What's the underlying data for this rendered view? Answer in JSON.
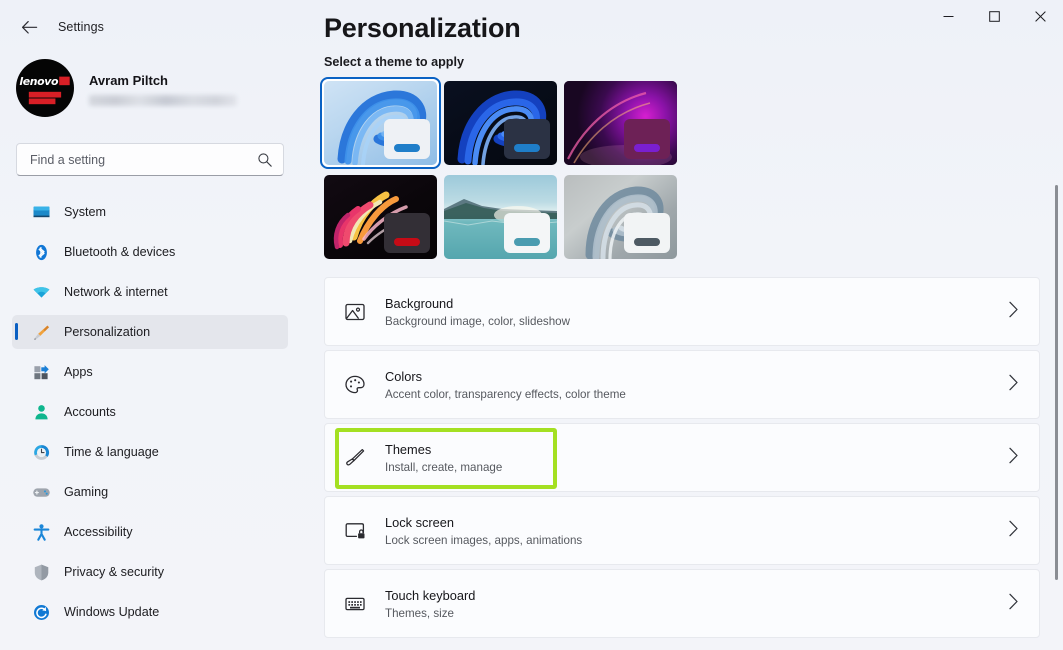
{
  "window": {
    "app_title": "Settings",
    "back_icon": "back-arrow-icon",
    "controls": {
      "minimize_label": "Minimize",
      "maximize_label": "Maximize",
      "close_label": "Close"
    }
  },
  "account": {
    "name": "Avram Piltch",
    "email_redacted": true,
    "avatar_logo_text": "lenovo"
  },
  "search": {
    "placeholder": "Find a setting",
    "value": "",
    "icon": "search-icon"
  },
  "sidebar": {
    "items": [
      {
        "label": "System",
        "icon": "monitor-icon",
        "active": false
      },
      {
        "label": "Bluetooth & devices",
        "icon": "bluetooth-icon",
        "active": false
      },
      {
        "label": "Network & internet",
        "icon": "wifi-icon",
        "active": false
      },
      {
        "label": "Personalization",
        "icon": "paintbrush-icon",
        "active": true
      },
      {
        "label": "Apps",
        "icon": "apps-icon",
        "active": false
      },
      {
        "label": "Accounts",
        "icon": "person-icon",
        "active": false
      },
      {
        "label": "Time & language",
        "icon": "clock-icon",
        "active": false
      },
      {
        "label": "Gaming",
        "icon": "gamepad-icon",
        "active": false
      },
      {
        "label": "Accessibility",
        "icon": "accessibility-icon",
        "active": false
      },
      {
        "label": "Privacy & security",
        "icon": "shield-icon",
        "active": false
      },
      {
        "label": "Windows Update",
        "icon": "update-icon",
        "active": false
      }
    ]
  },
  "main": {
    "page_title": "Personalization",
    "section_label": "Select a theme to apply",
    "themes": [
      {
        "name": "Windows light bloom",
        "selected": true,
        "accent": "#1f7ec9",
        "win_bg": "#eef1f5"
      },
      {
        "name": "Windows dark bloom",
        "selected": false,
        "accent": "#1f7ec9",
        "win_bg": "#2b3244"
      },
      {
        "name": "Purple glow",
        "selected": false,
        "accent": "#7a1fd0",
        "win_bg": "#6d2156"
      },
      {
        "name": "Flow flowers dark",
        "selected": false,
        "accent": "#c60b16",
        "win_bg": "#332f36"
      },
      {
        "name": "Captured motion lake",
        "selected": false,
        "accent": "#4a9cb0",
        "win_bg": "#f4f6f7"
      },
      {
        "name": "Flow light",
        "selected": false,
        "accent": "#4e5a63",
        "win_bg": "#f2f4f5"
      }
    ],
    "settings_rows": [
      {
        "title": "Background",
        "subtitle": "Background image, color, slideshow",
        "icon": "image-icon",
        "highlighted": false
      },
      {
        "title": "Colors",
        "subtitle": "Accent color, transparency effects, color theme",
        "icon": "palette-icon",
        "highlighted": false
      },
      {
        "title": "Themes",
        "subtitle": "Install, create, manage",
        "icon": "paintbrush-icon",
        "highlighted": true
      },
      {
        "title": "Lock screen",
        "subtitle": "Lock screen images, apps, animations",
        "icon": "lock-screen-icon",
        "highlighted": false
      },
      {
        "title": "Touch keyboard",
        "subtitle": "Themes, size",
        "icon": "keyboard-icon",
        "highlighted": false
      }
    ]
  },
  "colors": {
    "accent_blue": "#0a62c4",
    "highlight_green": "#a4e022",
    "page_background": "#f1f3f9",
    "card_background": "#fbfcfe"
  }
}
